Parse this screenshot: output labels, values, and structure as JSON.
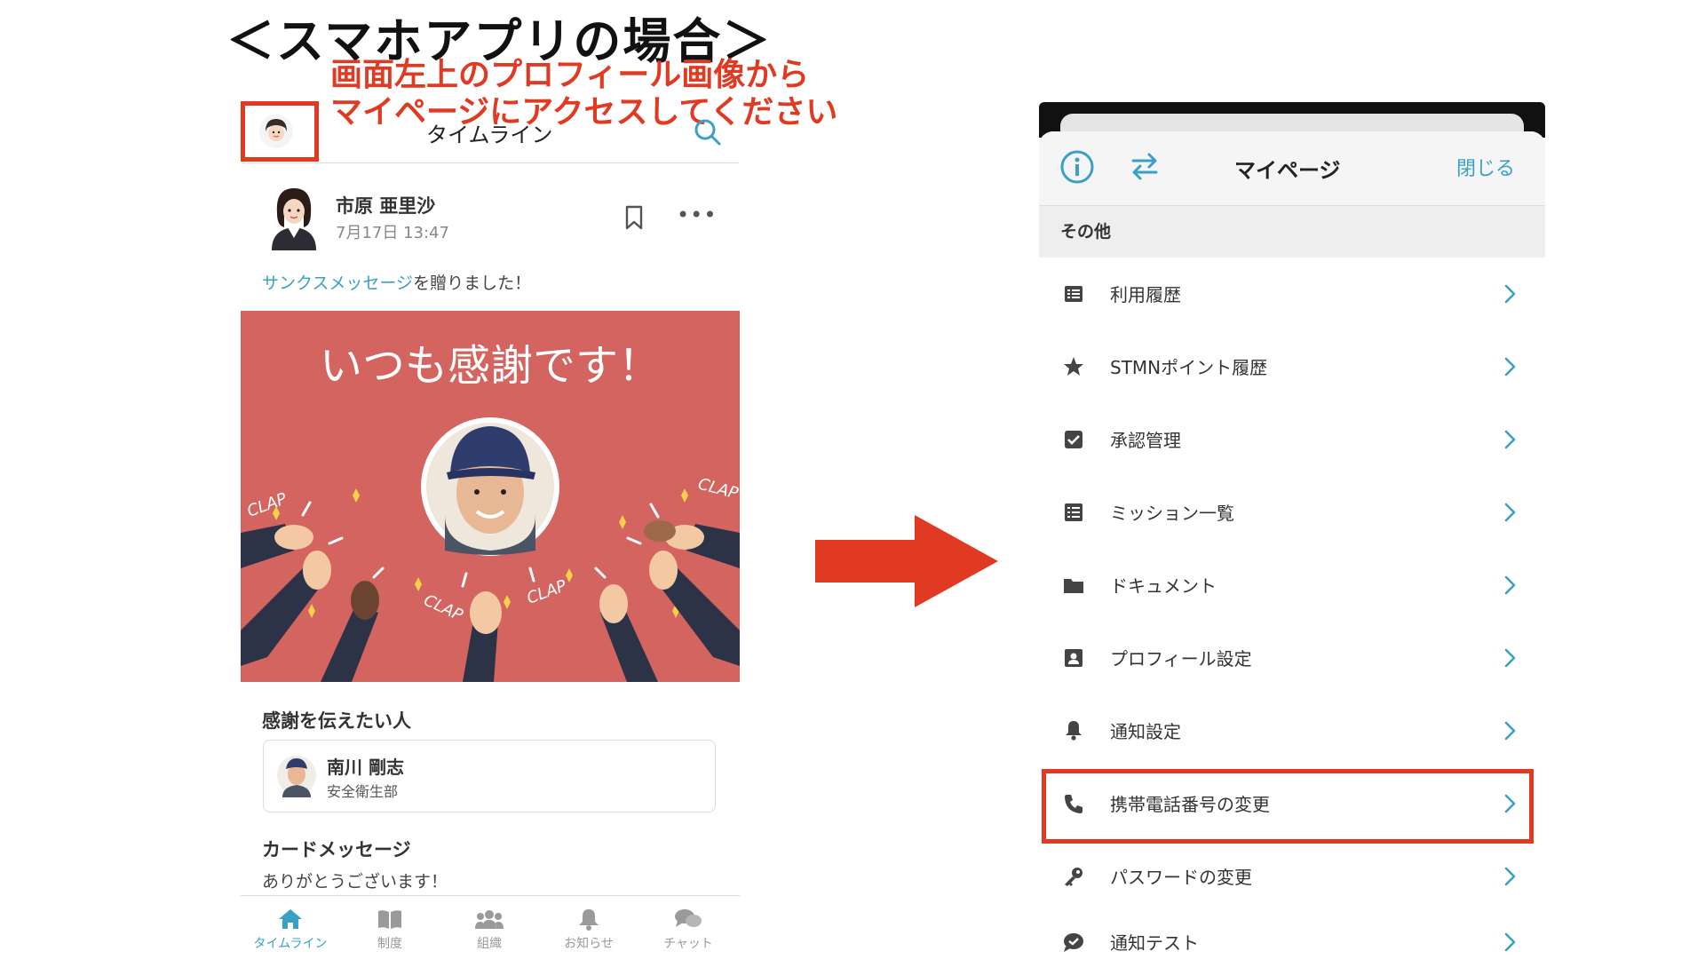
{
  "heading": {
    "title": "＜スマホアプリの場合＞",
    "instruction_line1": "画面左上のプロフィール画像から",
    "instruction_line2": "マイページにアクセスしてください"
  },
  "colors": {
    "accent": "#3aa0c4",
    "highlight_red": "#e03a22",
    "card_bg": "#d4645f"
  },
  "timeline": {
    "header_title": "タイムライン",
    "post": {
      "author": "市原 亜里沙",
      "time": "7月17日 13:47",
      "action_link": "サンクスメッセージ",
      "action_rest": "を贈りました！",
      "card_text": "いつも感謝です！",
      "clap_word": "CLAP"
    },
    "recipient_label": "感謝を伝えたい人",
    "recipient": {
      "name": "南川 剛志",
      "dept": "安全衛生部"
    },
    "message_label": "カードメッセージ",
    "message": "ありがとうございます！",
    "tabs": [
      {
        "label": "タイムライン",
        "icon": "home-icon",
        "active": true
      },
      {
        "label": "制度",
        "icon": "book-icon",
        "active": false
      },
      {
        "label": "組織",
        "icon": "users-icon",
        "active": false
      },
      {
        "label": "お知らせ",
        "icon": "bell-icon",
        "active": false
      },
      {
        "label": "チャット",
        "icon": "chat-icon",
        "active": false
      }
    ]
  },
  "mypage": {
    "title": "マイページ",
    "close_label": "閉じる",
    "section_label": "その他",
    "items": [
      {
        "label": "利用履歴",
        "icon": "list-icon"
      },
      {
        "label": "STMNポイント履歴",
        "icon": "star-icon"
      },
      {
        "label": "承認管理",
        "icon": "checkbox-icon"
      },
      {
        "label": "ミッション一覧",
        "icon": "list-icon"
      },
      {
        "label": "ドキュメント",
        "icon": "folder-icon"
      },
      {
        "label": "プロフィール設定",
        "icon": "profile-card-icon"
      },
      {
        "label": "通知設定",
        "icon": "bell-icon"
      },
      {
        "label": "携帯電話番号の変更",
        "icon": "phone-icon"
      },
      {
        "label": "パスワードの変更",
        "icon": "key-icon"
      },
      {
        "label": "通知テスト",
        "icon": "chat-check-icon"
      }
    ]
  }
}
